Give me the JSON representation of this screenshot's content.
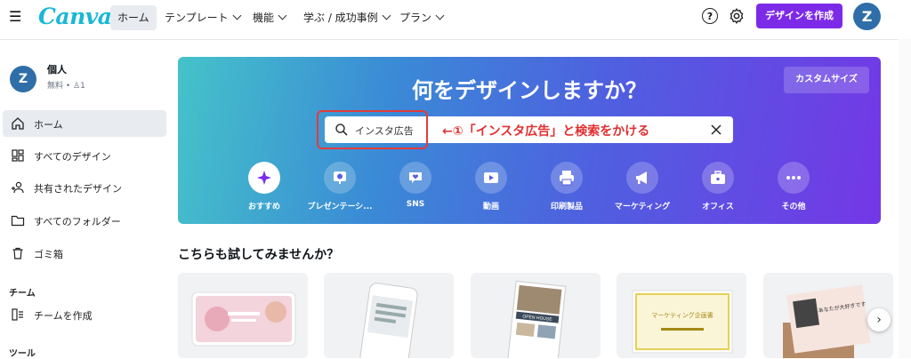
{
  "header": {
    "logo": "Canva",
    "nav": [
      {
        "label": "ホーム",
        "active": true,
        "dropdown": false
      },
      {
        "label": "テンプレート",
        "dropdown": true
      },
      {
        "label": "機能",
        "dropdown": true
      },
      {
        "label": "学ぶ / 成功事例",
        "dropdown": true
      },
      {
        "label": "プラン",
        "dropdown": true
      }
    ],
    "help_label": "?",
    "create_button": "デザインを作成",
    "avatar_initial": "Z",
    "accent_color": "#7d2ae8"
  },
  "sidebar": {
    "avatar_initial": "Z",
    "user_name": "個人",
    "user_sub": "無料 • ",
    "member_count": "1",
    "items": [
      {
        "label": "ホーム",
        "icon": "home-icon",
        "active": true
      },
      {
        "label": "すべてのデザイン",
        "icon": "grid-icon"
      },
      {
        "label": "共有されたデザイン",
        "icon": "shared-users-icon"
      },
      {
        "label": "すべてのフォルダー",
        "icon": "folder-icon"
      },
      {
        "label": "ゴミ箱",
        "icon": "trash-icon"
      }
    ],
    "team_section": "チーム",
    "team_item": "チームを作成",
    "tools_section": "ツール"
  },
  "hero": {
    "title": "何をデザインしますか？",
    "custom_size": "カスタムサイズ",
    "search_value": "インスタ広告",
    "annotation": "←①「インスタ広告」と検索をかける",
    "categories": [
      {
        "label": "おすすめ",
        "icon": "sparkle-icon",
        "active": true
      },
      {
        "label": "プレゼンテーシ...",
        "icon": "presentation-icon"
      },
      {
        "label": "SNS",
        "icon": "heart-chat-icon"
      },
      {
        "label": "動画",
        "icon": "video-icon"
      },
      {
        "label": "印刷製品",
        "icon": "printer-icon"
      },
      {
        "label": "マーケティング",
        "icon": "megaphone-icon"
      },
      {
        "label": "オフィス",
        "icon": "briefcase-icon"
      },
      {
        "label": "その他",
        "icon": "more-icon"
      }
    ]
  },
  "suggestions": {
    "title": "こちらも試してみませんか？",
    "cards": [
      {
        "name": "presentation-template"
      },
      {
        "name": "instagram-post-template"
      },
      {
        "name": "flyer-template",
        "caption": "OPEN HOUSE"
      },
      {
        "name": "document-template",
        "caption": "マーケティング企画書"
      },
      {
        "name": "card-template",
        "caption": "あなたが大好きです"
      }
    ]
  }
}
